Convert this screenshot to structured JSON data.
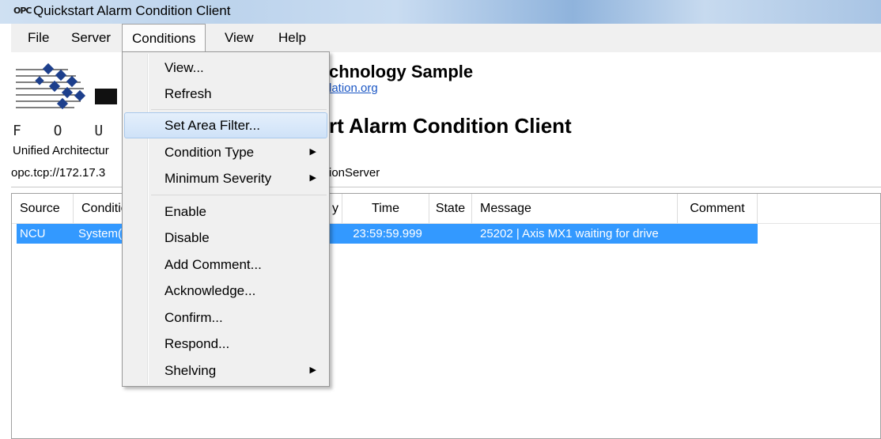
{
  "window": {
    "icon": "opc-app-icon",
    "icon_text": "OPC",
    "title": "Quickstart Alarm Condition Client"
  },
  "menubar": {
    "file": "File",
    "server": "Server",
    "conditions": "Conditions",
    "view": "View",
    "help": "Help"
  },
  "header": {
    "logo_icon": "opc-foundation-logo",
    "foundation_text": "F O U N D",
    "ua_text": "Unified Architectur",
    "sample_title": "chnology Sample",
    "link_text": "lation.org",
    "main_title": "rt Alarm Condition Client"
  },
  "endpoint": {
    "url_visible": "opc.tcp://172.17.3",
    "url_tail": "ionServer"
  },
  "table": {
    "columns": [
      "Source",
      "Conditio",
      "y",
      "Time",
      "State",
      "Message",
      "Comment"
    ],
    "rows": [
      {
        "source": "NCU",
        "condition": "System(",
        "time": "23:59:59.999",
        "state": "",
        "message": "25202 | Axis MX1 waiting for drive",
        "comment": ""
      }
    ],
    "selected_row_color": "#3399ff"
  },
  "conditions_menu": {
    "items": [
      {
        "label": "View...",
        "submenu": false
      },
      {
        "label": "Refresh",
        "submenu": false
      },
      {
        "label": "Set Area Filter...",
        "submenu": false,
        "highlighted": true
      },
      {
        "label": "Condition Type",
        "submenu": true
      },
      {
        "label": "Minimum Severity",
        "submenu": true
      },
      {
        "label": "Enable",
        "submenu": false
      },
      {
        "label": "Disable",
        "submenu": false
      },
      {
        "label": "Add Comment...",
        "submenu": false
      },
      {
        "label": "Acknowledge...",
        "submenu": false
      },
      {
        "label": "Confirm...",
        "submenu": false
      },
      {
        "label": "Respond...",
        "submenu": false
      },
      {
        "label": "Shelving",
        "submenu": true
      }
    ],
    "submenu_arrow_icon": "chevron-right-icon",
    "submenu_arrow_glyph": "▶"
  }
}
